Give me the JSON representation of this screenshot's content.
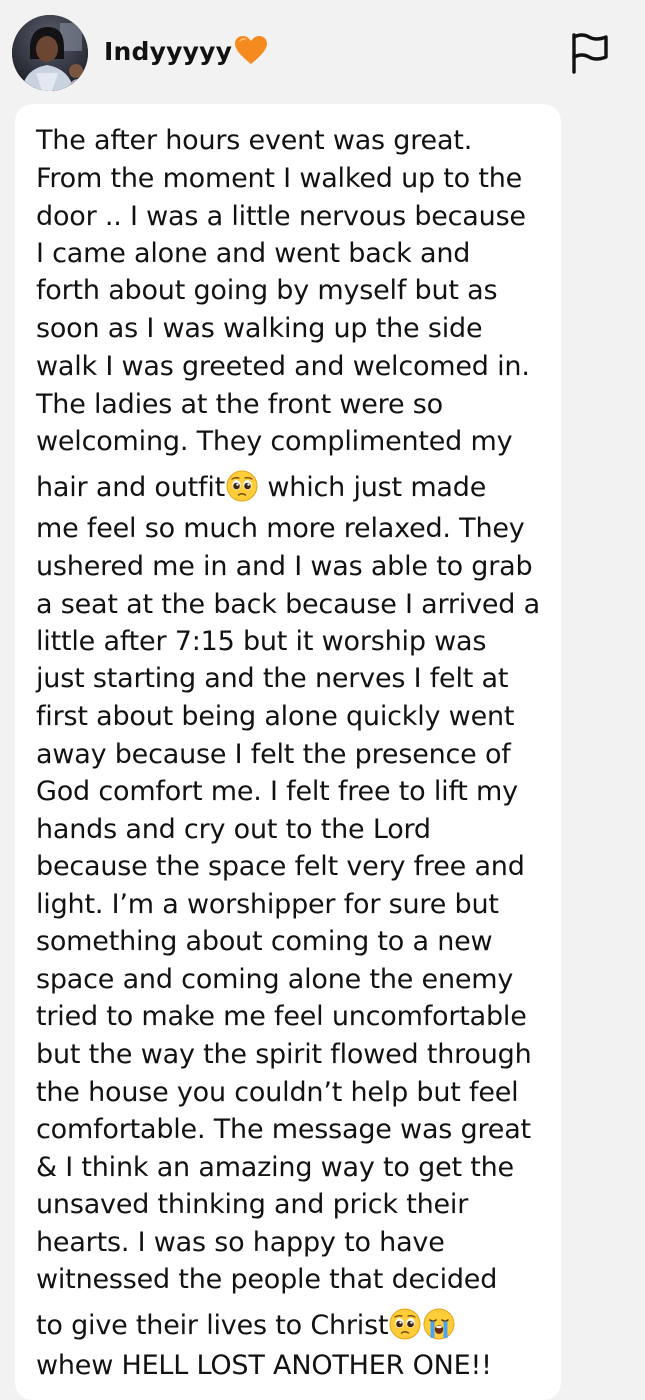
{
  "post": {
    "author": {
      "name": "Indyyyyy",
      "name_emoji": "orange-heart-icon"
    },
    "flag_icon": "flag-icon",
    "body": {
      "line_01": "The after hours event was great.",
      "line_02": "From the moment I walked up to the",
      "line_03": "door .. I was a little nervous because",
      "line_04": "I came alone and went back and",
      "line_05": "forth about going by myself but as",
      "line_06": "soon as I was walking up the side",
      "line_07": "walk I was greeted and welcomed in.",
      "line_08": "The ladies at the front were so",
      "line_09": "welcoming. They complimented my",
      "line_10a": "hair and outfit",
      "line_10b": " which just made",
      "line_11": "me feel so much more relaxed. They",
      "line_12": "ushered me in and I was able to grab",
      "line_13": "a seat at the back because I arrived a",
      "line_14": "little after 7:15 but it worship was",
      "line_15": "just starting and the nerves I felt at",
      "line_16": "first about being alone quickly went",
      "line_17": "away because I felt the presence of",
      "line_18": "God comfort me. I felt free to lift my",
      "line_19": "hands and cry out to the Lord",
      "line_20": "because the space felt very free and",
      "line_21": "light. I’m a worshipper for sure but",
      "line_22": "something about coming to a new",
      "line_23": "space and coming alone the enemy",
      "line_24": "tried to make me feel uncomfortable",
      "line_25": "but the way the spirit flowed through",
      "line_26": "the house you couldn’t help but feel",
      "line_27": "comfortable. The message was great",
      "line_28": "& I think an amazing way to get the",
      "line_29": "unsaved thinking and prick their",
      "line_30": "hearts. I was so happy to have",
      "line_31": "witnessed the people that decided",
      "line_32": "to give their lives to Christ",
      "line_33": "whew HELL LOST ANOTHER ONE!!"
    },
    "emojis": [
      "pleading-face-icon",
      "pleading-face-icon",
      "loudly-crying-face-icon"
    ]
  },
  "colors": {
    "background": "#f2f2f2",
    "bubble": "#ffffff",
    "text": "#121212",
    "heart": "#f58a1f"
  }
}
